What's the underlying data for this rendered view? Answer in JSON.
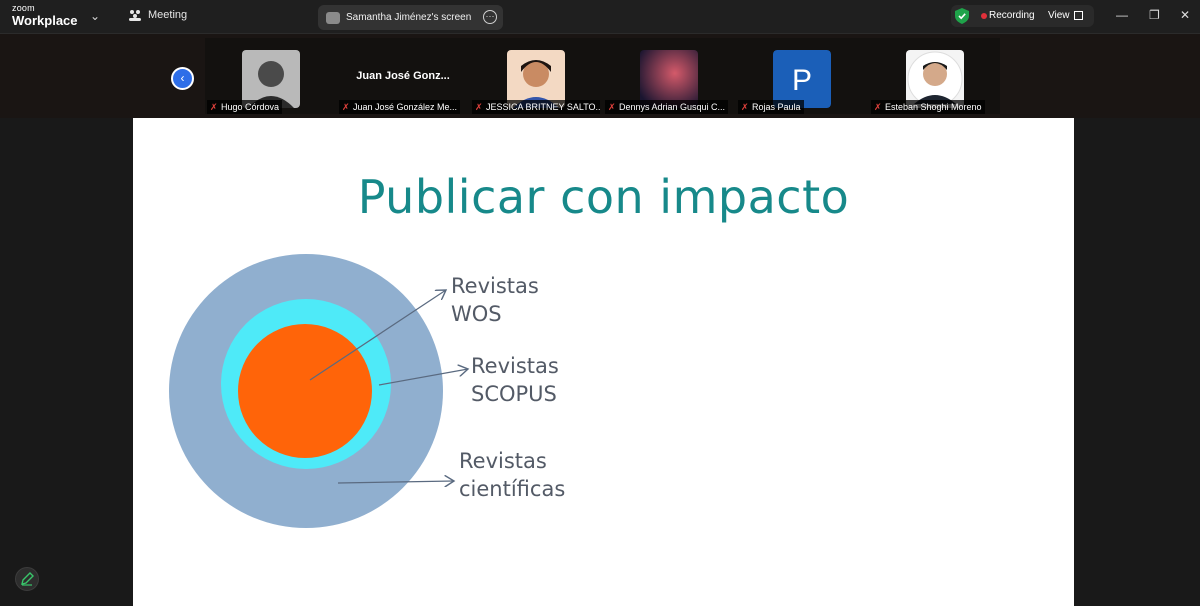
{
  "app": {
    "logo_small": "zoom",
    "logo_big": "Workplace",
    "meeting_menu": "Meeting"
  },
  "share_tab": {
    "title": "Samantha Jiménez's screen"
  },
  "status": {
    "recording": "Recording",
    "view": "View",
    "recording_color": "#e0303a",
    "shield_color": "#1fa34a"
  },
  "participants": [
    {
      "label": "Hugo Córdova",
      "avatar": "photo"
    },
    {
      "label": "Juan José González Me...",
      "display_name": "Juan José Gonz..."
    },
    {
      "label": "JESSICA BRITNEY SALTO...",
      "avatar": "photo"
    },
    {
      "label": "Dennys Adrian Gusqui C...",
      "avatar": "photo"
    },
    {
      "label": "Rojas Paula",
      "avatar_letter": "P",
      "avatar_color": "#1b5fb8"
    },
    {
      "label": "Esteban Shoghi Moreno",
      "avatar": "photo"
    }
  ],
  "slide": {
    "title": "Publicar con impacto",
    "labels": {
      "wos": [
        "Revistas",
        "WOS"
      ],
      "scopus": [
        "Revistas",
        "SCOPUS"
      ],
      "cientificas": [
        "Revistas",
        "científicas"
      ]
    },
    "colors": {
      "outer": "#90afcf",
      "middle": "#4eeaf8",
      "inner": "#ff6409",
      "title": "#17898a"
    }
  }
}
